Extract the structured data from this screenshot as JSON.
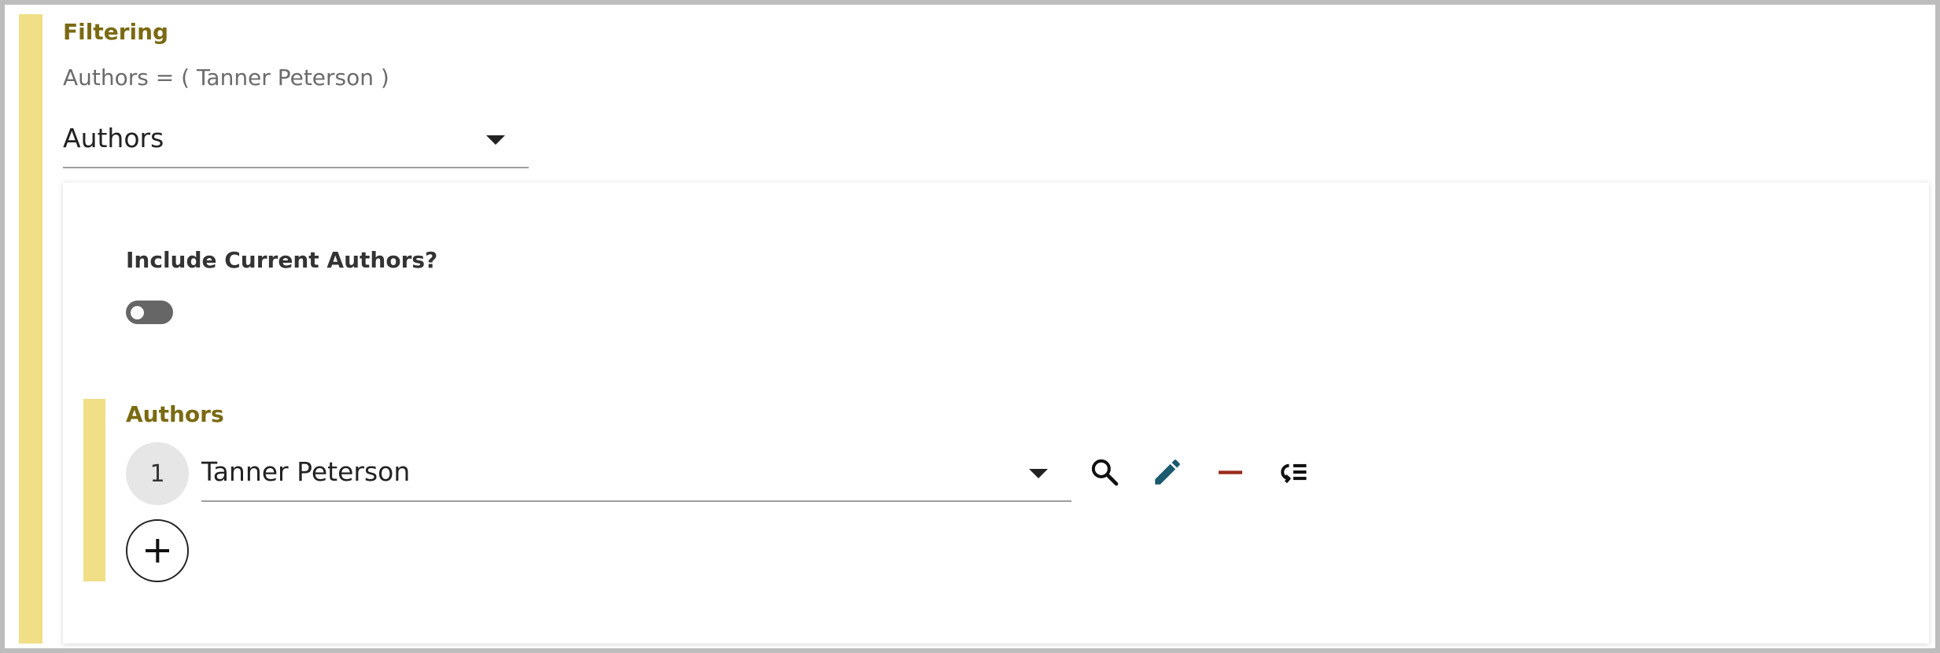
{
  "filtering": {
    "title": "Filtering",
    "summary": "Authors = ( Tanner Peterson )",
    "field_select": {
      "value": "Authors"
    }
  },
  "panel": {
    "include_current": {
      "label": "Include Current Authors?",
      "enabled": false
    },
    "authors": {
      "title": "Authors",
      "rows": [
        {
          "number": "1",
          "value": "Tanner Peterson"
        }
      ]
    },
    "actions": {
      "search_icon": "search-icon",
      "edit_icon": "edit-icon",
      "remove_icon": "minus-icon",
      "list_icon": "list-reorder-icon",
      "add_icon": "plus-icon"
    }
  },
  "colors": {
    "accent_bar": "#f0df87",
    "title_text": "#7a6a12",
    "edit_icon": "#1c5a6e",
    "remove_icon": "#9a2a1a"
  }
}
